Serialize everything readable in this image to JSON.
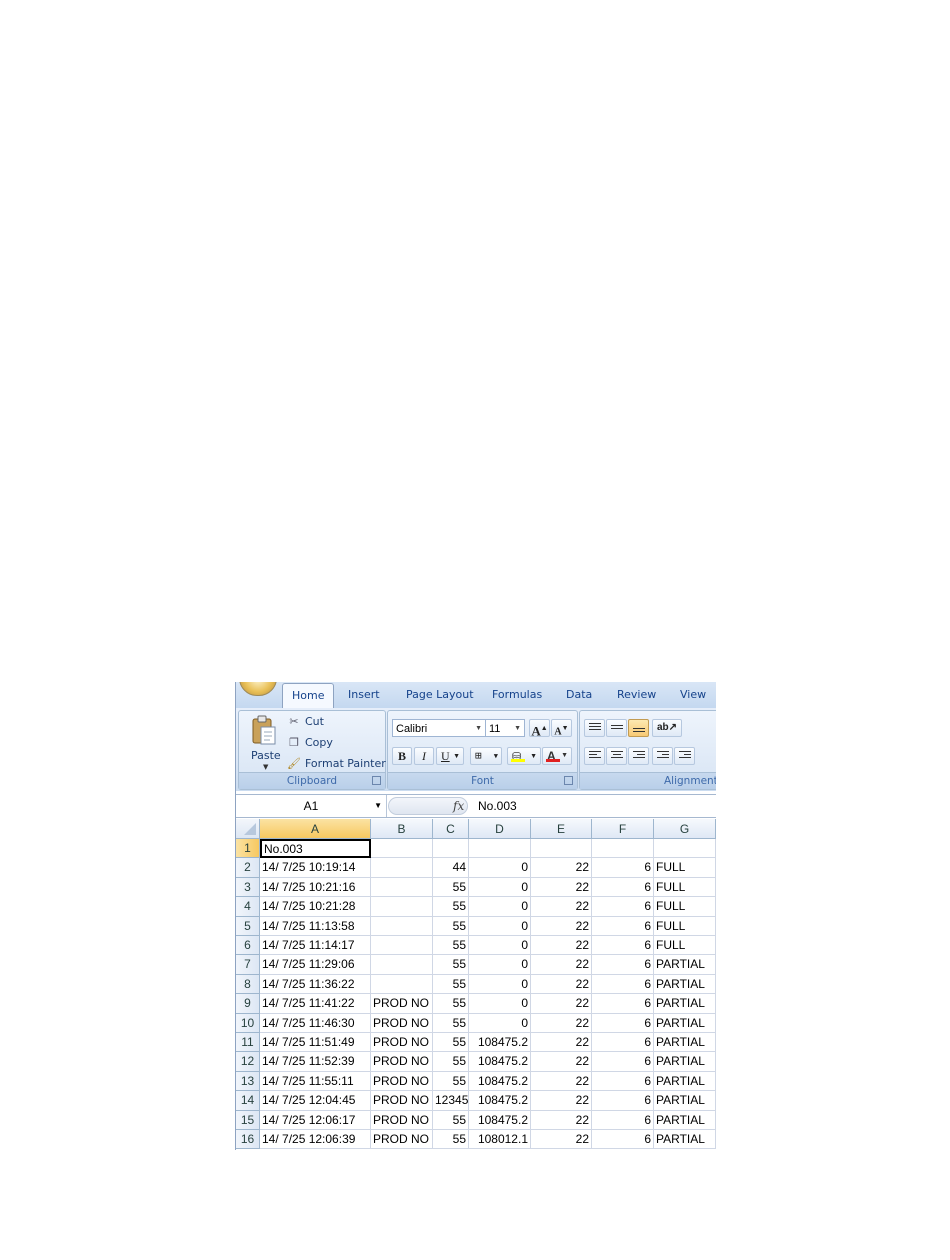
{
  "ribbon": {
    "tabs": [
      "Home",
      "Insert",
      "Page Layout",
      "Formulas",
      "Data",
      "Review",
      "View"
    ],
    "active_tab": "Home",
    "clipboard": {
      "label": "Clipboard",
      "paste": "Paste",
      "cut": "Cut",
      "copy": "Copy",
      "format_painter": "Format Painter"
    },
    "font": {
      "label": "Font",
      "name": "Calibri",
      "size": "11",
      "bold": "B",
      "italic": "I",
      "underline": "U",
      "grow": "A",
      "shrink": "A",
      "font_color_glyph": "A",
      "font_color": "#e02020",
      "fill_color": "#ffff00"
    },
    "alignment": {
      "label": "Alignment"
    }
  },
  "formula_bar": {
    "name_box": "A1",
    "fx": "fx",
    "value": "No.003"
  },
  "sheet": {
    "active_cell": "A1",
    "columns": [
      "A",
      "B",
      "C",
      "D",
      "E",
      "F",
      "G"
    ],
    "rows": [
      {
        "n": "1",
        "cells": [
          "No.003",
          "",
          "",
          "",
          "",
          "",
          ""
        ]
      },
      {
        "n": "2",
        "cells": [
          "14/ 7/25 10:19:14",
          "",
          "44",
          "0",
          "22",
          "6",
          "FULL"
        ]
      },
      {
        "n": "3",
        "cells": [
          "14/ 7/25 10:21:16",
          "",
          "55",
          "0",
          "22",
          "6",
          "FULL"
        ]
      },
      {
        "n": "4",
        "cells": [
          "14/ 7/25 10:21:28",
          "",
          "55",
          "0",
          "22",
          "6",
          "FULL"
        ]
      },
      {
        "n": "5",
        "cells": [
          "14/ 7/25 11:13:58",
          "",
          "55",
          "0",
          "22",
          "6",
          "FULL"
        ]
      },
      {
        "n": "6",
        "cells": [
          "14/ 7/25 11:14:17",
          "",
          "55",
          "0",
          "22",
          "6",
          "FULL"
        ]
      },
      {
        "n": "7",
        "cells": [
          "14/ 7/25 11:29:06",
          "",
          "55",
          "0",
          "22",
          "6",
          "PARTIAL"
        ]
      },
      {
        "n": "8",
        "cells": [
          "14/ 7/25 11:36:22",
          "",
          "55",
          "0",
          "22",
          "6",
          "PARTIAL"
        ]
      },
      {
        "n": "9",
        "cells": [
          "14/ 7/25 11:41:22",
          "PROD NO",
          "55",
          "0",
          "22",
          "6",
          "PARTIAL"
        ]
      },
      {
        "n": "10",
        "cells": [
          "14/ 7/25 11:46:30",
          "PROD NO",
          "55",
          "0",
          "22",
          "6",
          "PARTIAL"
        ]
      },
      {
        "n": "11",
        "cells": [
          "14/ 7/25 11:51:49",
          "PROD NO",
          "55",
          "108475.2",
          "22",
          "6",
          "PARTIAL"
        ]
      },
      {
        "n": "12",
        "cells": [
          "14/ 7/25 11:52:39",
          "PROD NO",
          "55",
          "108475.2",
          "22",
          "6",
          "PARTIAL"
        ]
      },
      {
        "n": "13",
        "cells": [
          "14/ 7/25 11:55:11",
          "PROD NO",
          "55",
          "108475.2",
          "22",
          "6",
          "PARTIAL"
        ]
      },
      {
        "n": "14",
        "cells": [
          "14/ 7/25 12:04:45",
          "PROD NO",
          "12345",
          "108475.2",
          "22",
          "6",
          "PARTIAL"
        ]
      },
      {
        "n": "15",
        "cells": [
          "14/ 7/25 12:06:17",
          "PROD NO",
          "55",
          "108475.2",
          "22",
          "6",
          "PARTIAL"
        ]
      },
      {
        "n": "16",
        "cells": [
          "14/ 7/25 12:06:39",
          "PROD NO",
          "55",
          "108012.1",
          "22",
          "6",
          "PARTIAL"
        ]
      }
    ]
  }
}
